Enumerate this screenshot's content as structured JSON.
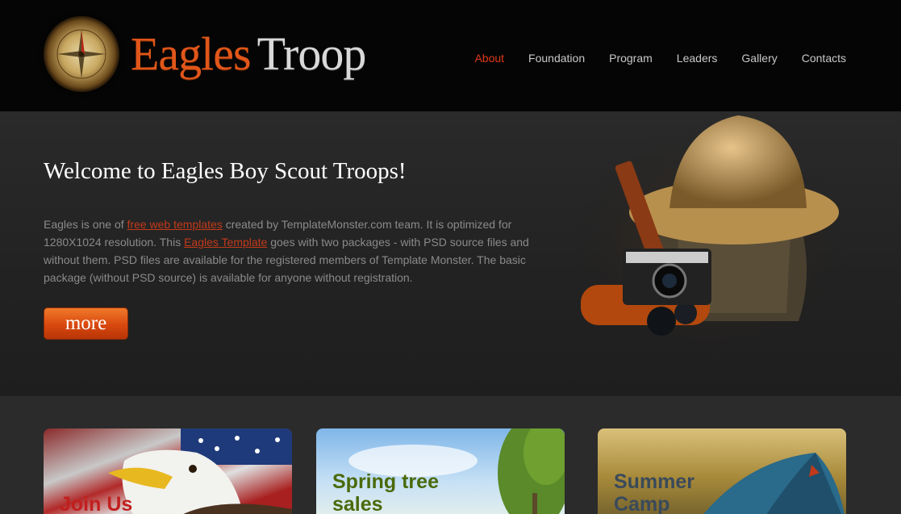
{
  "header": {
    "logo_primary": "Eagles",
    "logo_secondary": "Troop",
    "nav": [
      {
        "label": "About",
        "active": true
      },
      {
        "label": "Foundation",
        "active": false
      },
      {
        "label": "Program",
        "active": false
      },
      {
        "label": "Leaders",
        "active": false
      },
      {
        "label": "Gallery",
        "active": false
      },
      {
        "label": "Contacts",
        "active": false
      }
    ]
  },
  "hero": {
    "title": "Welcome to Eagles Boy Scout Troops!",
    "text_1": "Eagles is one of ",
    "link_1": "free web templates",
    "text_2": " created by TemplateMonster.com team. It is optimized for 1280X1024 resolution. This ",
    "link_2": "Eagles Template",
    "text_3": " goes with two packages - with PSD source files and without them. PSD files are available for the registered members of Template Monster. The basic package (without PSD source) is available for anyone without registration.",
    "button": "more"
  },
  "cards": [
    {
      "title_line1": "Join Us",
      "title_line2": "",
      "color": "#c21f1f"
    },
    {
      "title_line1": "Spring tree",
      "title_line2": "sales",
      "color": "#4a6a0a"
    },
    {
      "title_line1": "Summer",
      "title_line2": "Camp",
      "color": "#3a4a5a"
    }
  ],
  "colors": {
    "accent": "#e0561a",
    "nav_active": "#e0391a",
    "link": "#c33a1a"
  }
}
